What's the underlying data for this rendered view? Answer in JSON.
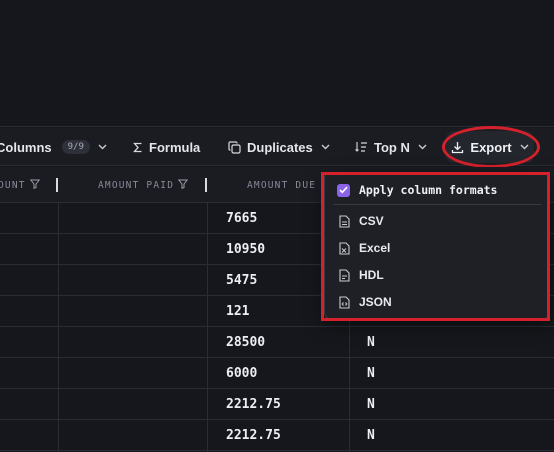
{
  "toolbar": {
    "columns_label": "Columns",
    "columns_badge": "9/9",
    "formula_label": "Formula",
    "duplicates_label": "Duplicates",
    "topn_label": "Top N",
    "export_label": "Export"
  },
  "table": {
    "headers": [
      "OUNT",
      "AMOUNT PAID",
      "AMOUNT DUE"
    ],
    "rows": [
      {
        "amount_due": "7665",
        "flag": ""
      },
      {
        "amount_due": "10950",
        "flag": ""
      },
      {
        "amount_due": "5475",
        "flag": ""
      },
      {
        "amount_due": "121",
        "flag": ""
      },
      {
        "amount_due": "28500",
        "flag": "N"
      },
      {
        "amount_due": "6000",
        "flag": "N"
      },
      {
        "amount_due": "2212.75",
        "flag": "N"
      },
      {
        "amount_due": "2212.75",
        "flag": "N"
      }
    ]
  },
  "export_menu": {
    "apply_formats_label": "Apply column formats",
    "apply_formats_checked": true,
    "items": [
      "CSV",
      "Excel",
      "HDL",
      "JSON"
    ]
  },
  "colors": {
    "accent_purple": "#8a63e8",
    "annotation_red": "#d4212b",
    "background": "#16171c"
  },
  "icons": {
    "formula": "sigma-icon",
    "duplicates": "copy-icon",
    "topn": "sort-list-icon",
    "export": "download-icon",
    "filter": "filter-icon",
    "file": "file-icon"
  }
}
